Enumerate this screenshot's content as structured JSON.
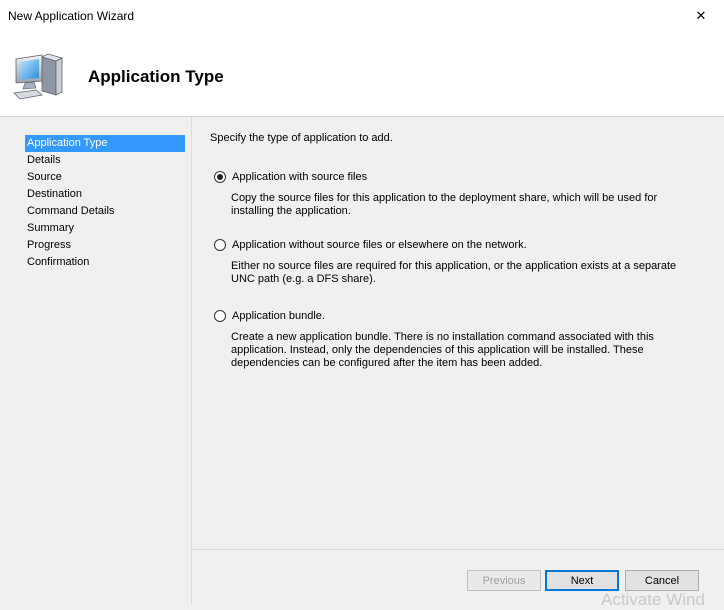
{
  "window": {
    "title": "New Application Wizard",
    "close_glyph": "✕"
  },
  "header": {
    "icon": "computer-icon",
    "title": "Application Type"
  },
  "sidebar": {
    "items": [
      {
        "label": "Application Type",
        "active": true
      },
      {
        "label": "Details"
      },
      {
        "label": "Source"
      },
      {
        "label": "Destination"
      },
      {
        "label": "Command Details"
      },
      {
        "label": "Summary"
      },
      {
        "label": "Progress"
      },
      {
        "label": "Confirmation"
      }
    ]
  },
  "main": {
    "prompt": "Specify the type of application to add.",
    "options": [
      {
        "label": "Application with source files",
        "description": "Copy the source files for this application to the deployment share, which will be used for installing the application.",
        "selected": true
      },
      {
        "label": "Application without source files or elsewhere on the network.",
        "description": "Either no source files are required for this application, or the application exists at a separate UNC path (e.g. a DFS share).",
        "selected": false
      },
      {
        "label": "Application bundle.",
        "description": "Create a new application bundle.  There is no installation command associated with this application.  Instead, only the dependencies of this application will be installed.  These dependencies can be configured after the item has been added.",
        "selected": false
      }
    ]
  },
  "footer": {
    "previous_label": "Previous",
    "next_label": "Next",
    "cancel_label": "Cancel"
  },
  "watermark": "Activate Wind",
  "colors": {
    "selection": "#3399ff",
    "default_button_border": "#0078d7"
  }
}
